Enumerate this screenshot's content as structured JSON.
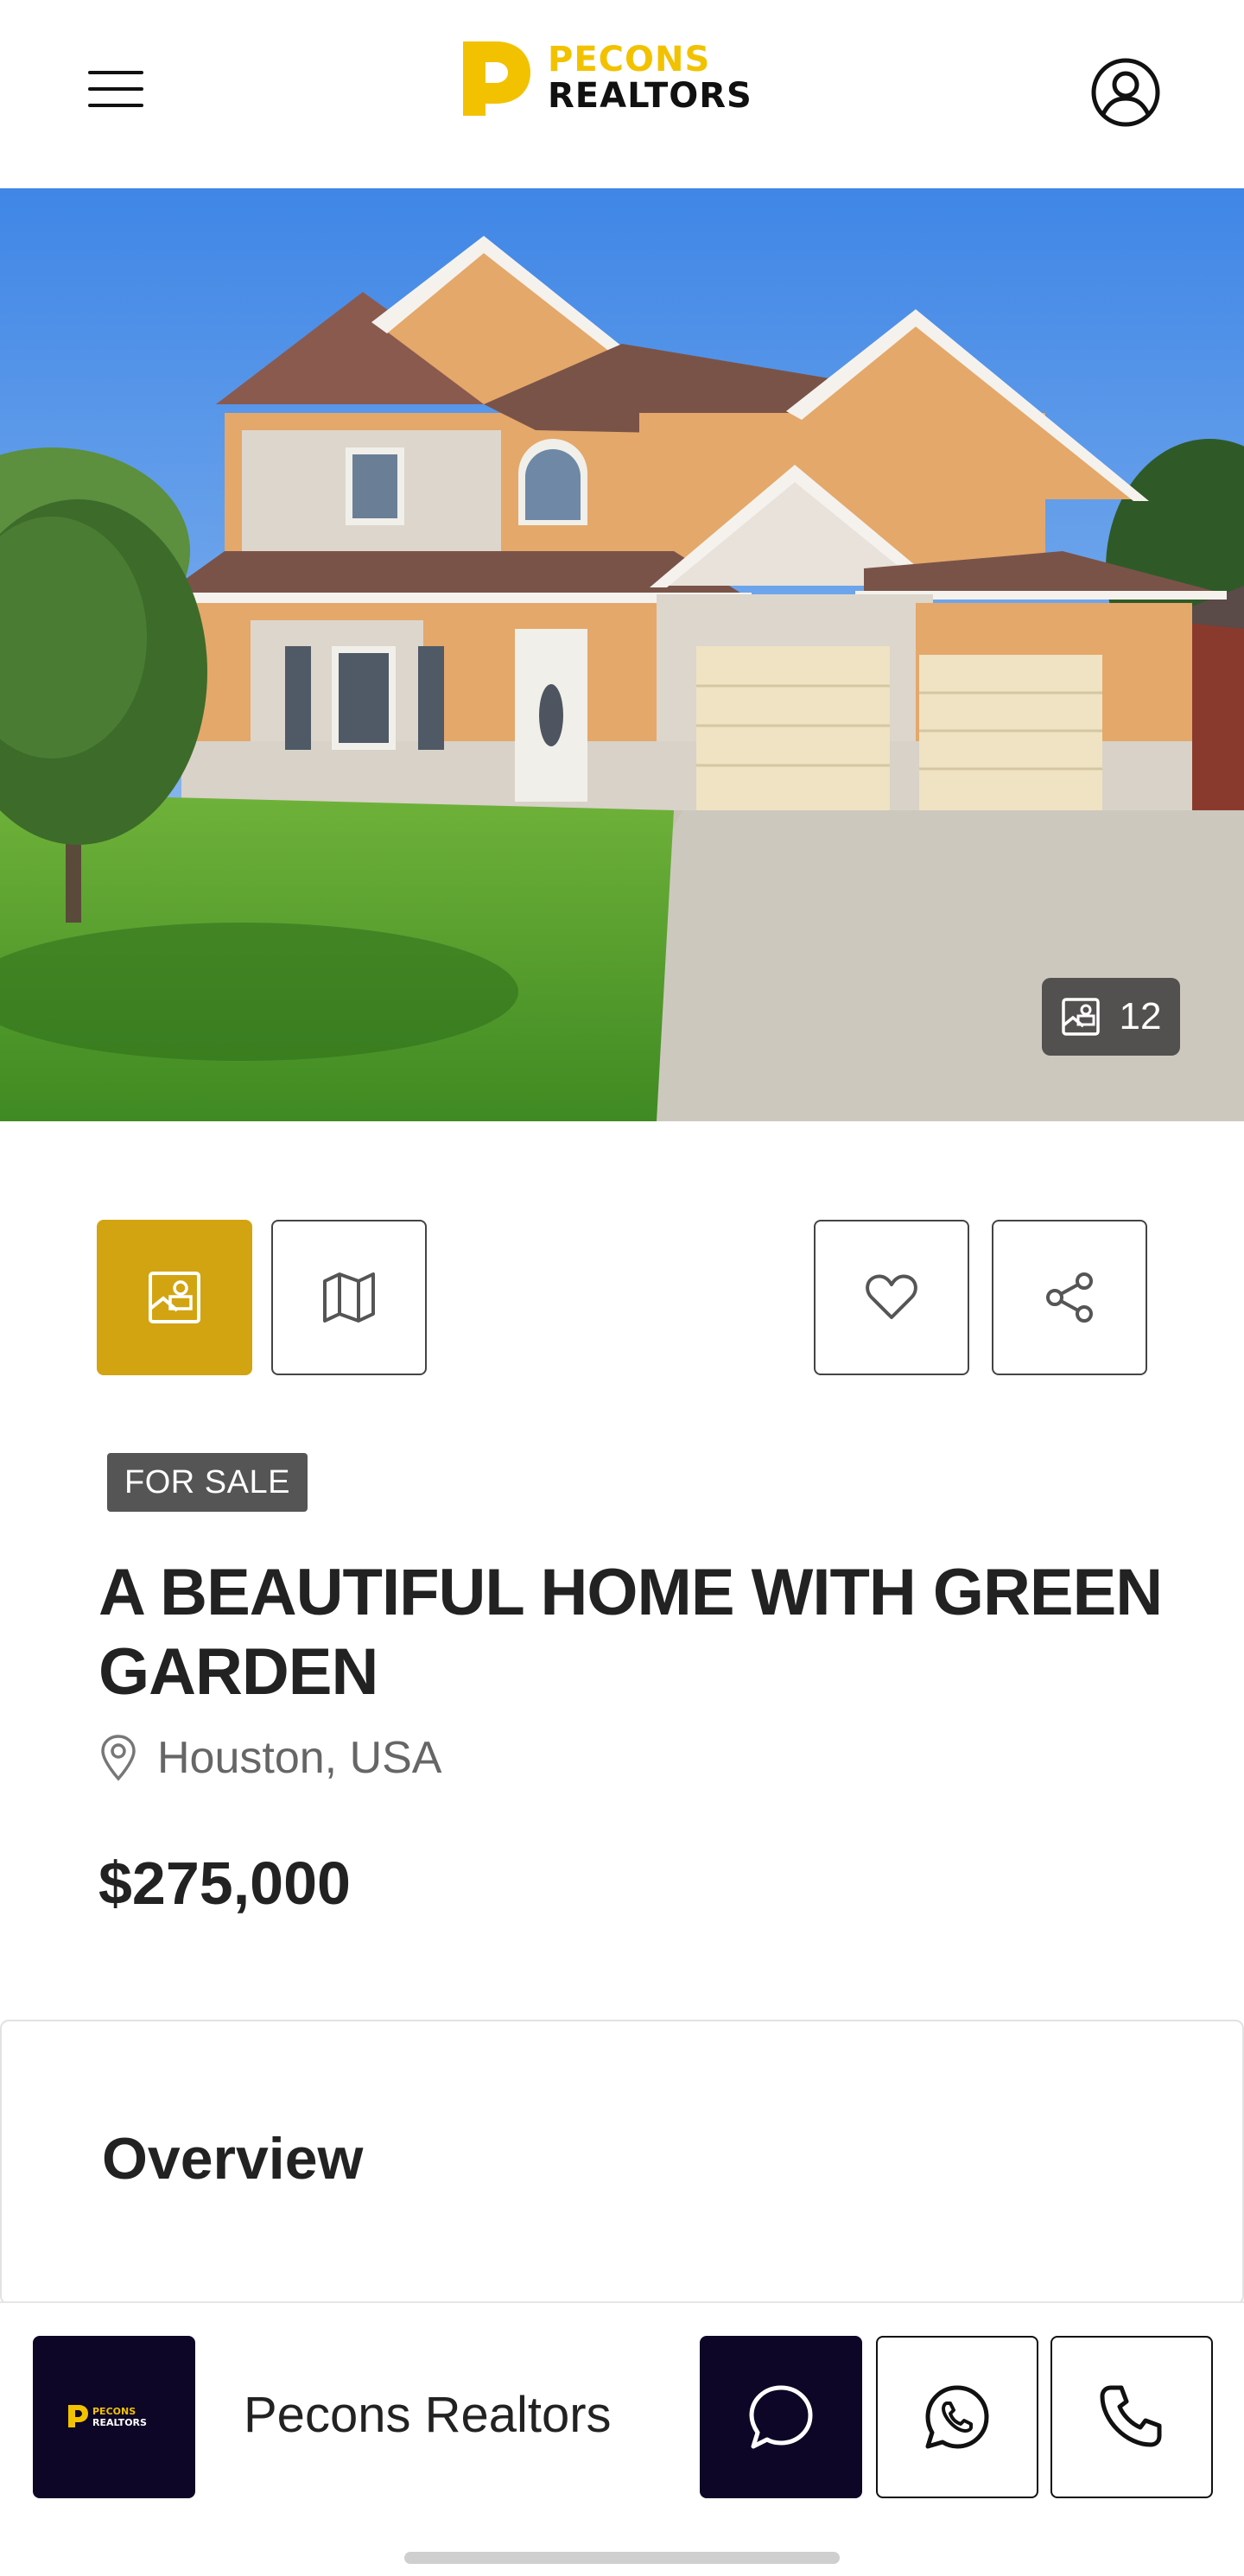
{
  "header": {
    "logo_line1": "PECONS",
    "logo_line2": "REALTORS",
    "menu_icon": "hamburger-menu-icon",
    "account_icon": "user-circle-icon"
  },
  "hero": {
    "photo_count": "12",
    "photo_count_icon": "image-icon"
  },
  "actions": {
    "gallery_icon": "image-icon",
    "map_icon": "map-icon",
    "favorite_icon": "heart-icon",
    "share_icon": "share-icon"
  },
  "listing": {
    "status": "FOR SALE",
    "title": "A BEAUTIFUL HOME WITH GREEN GARDEN",
    "location": "Houston, USA",
    "price": "$275,000"
  },
  "overview": {
    "heading": "Overview"
  },
  "agent": {
    "logo_line1": "PECONS",
    "logo_line2": "REALTORS",
    "name": "Pecons Realtors",
    "chat_icon": "chat-bubble-icon",
    "whatsapp_icon": "whatsapp-icon",
    "phone_icon": "phone-icon"
  },
  "colors": {
    "accent": "#d3a411",
    "brand_yellow": "#f2c200",
    "dark": "#0d0626",
    "badge": "#555555"
  }
}
